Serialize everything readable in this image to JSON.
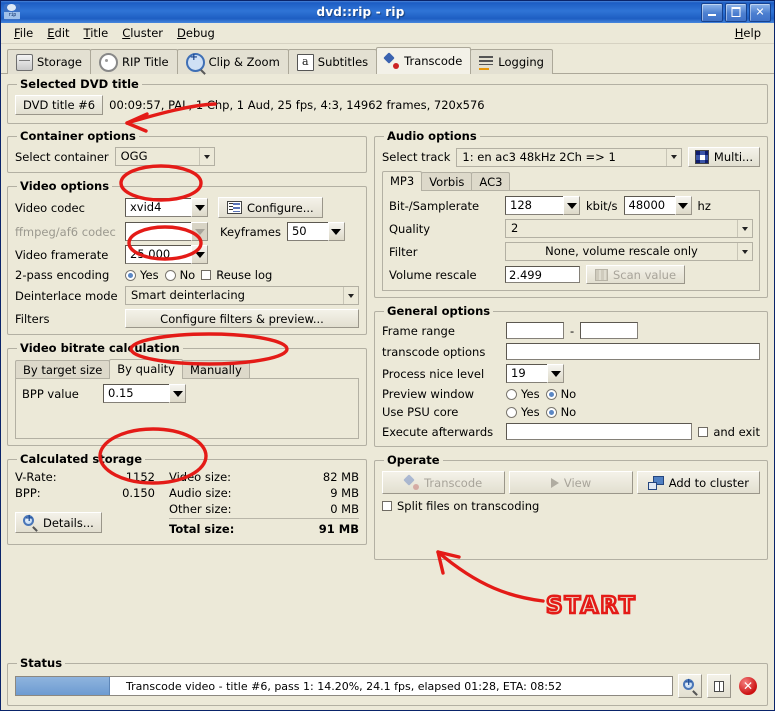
{
  "window": {
    "title": "dvd::rip - rip",
    "icon": "dvdrip-app-icon",
    "minimize_label": "_",
    "maximize_label": "□",
    "close_label": "✕"
  },
  "menubar": {
    "items": [
      {
        "label": "File",
        "mnemonic": "F"
      },
      {
        "label": "Edit",
        "mnemonic": "E"
      },
      {
        "label": "Title",
        "mnemonic": "T"
      },
      {
        "label": "Cluster",
        "mnemonic": "C"
      },
      {
        "label": "Debug",
        "mnemonic": "D"
      }
    ],
    "help": {
      "label": "Help",
      "mnemonic": "H"
    }
  },
  "tabs": [
    {
      "label": "Storage",
      "icon": "storage-icon",
      "active": false
    },
    {
      "label": "RIP Title",
      "icon": "rip-title-icon",
      "active": false
    },
    {
      "label": "Clip & Zoom",
      "icon": "clip-zoom-icon",
      "active": false
    },
    {
      "label": "Subtitles",
      "icon": "subtitles-icon",
      "active": false
    },
    {
      "label": "Transcode",
      "icon": "transcode-icon",
      "active": true
    },
    {
      "label": "Logging",
      "icon": "logging-icon",
      "active": false
    }
  ],
  "selected_dvd_title": {
    "legend": "Selected DVD title",
    "title_button": "DVD title #6",
    "info": "00:09:57, PAL, 1 Chp, 1 Aud, 25 fps, 4:3, 14962 frames, 720x576"
  },
  "container_options": {
    "legend": "Container options",
    "select_container_label": "Select container",
    "container_value": "OGG"
  },
  "video_options": {
    "legend": "Video options",
    "video_codec_label": "Video codec",
    "video_codec_value": "xvid4",
    "configure_button": "Configure...",
    "ffmpeg_codec_label": "ffmpeg/af6 codec",
    "ffmpeg_codec_value": "",
    "keyframes_label": "Keyframes",
    "keyframes_value": "50",
    "framerate_label": "Video framerate",
    "framerate_value": "25.000",
    "two_pass_label": "2-pass encoding",
    "two_pass_yes": "Yes",
    "two_pass_no": "No",
    "two_pass_selected": "Yes",
    "reuse_log_label": "Reuse log",
    "reuse_log_checked": false,
    "deinterlace_label": "Deinterlace mode",
    "deinterlace_value": "Smart deinterlacing",
    "filters_label": "Filters",
    "filters_button": "Configure filters & preview..."
  },
  "video_bitrate": {
    "legend": "Video bitrate calculation",
    "tabs": [
      {
        "label": "By target size",
        "active": false
      },
      {
        "label": "By quality",
        "active": true
      },
      {
        "label": "Manually",
        "active": false
      }
    ],
    "bpp_label": "BPP value",
    "bpp_value": "0.15"
  },
  "calculated_storage": {
    "legend": "Calculated storage",
    "vrate_label": "V-Rate:",
    "vrate_value": "1152",
    "bpp_label": "BPP:",
    "bpp_value": "0.150",
    "video_size_label": "Video size:",
    "video_size_value": "82 MB",
    "audio_size_label": "Audio size:",
    "audio_size_value": "9 MB",
    "other_size_label": "Other size:",
    "other_size_value": "0 MB",
    "total_size_label": "Total size:",
    "total_size_value": "91 MB",
    "details_button": "Details..."
  },
  "audio_options": {
    "legend": "Audio options",
    "select_track_label": "Select track",
    "select_track_value": "1: en ac3 48kHz 2Ch => 1",
    "multi_button": "Multi...",
    "tabs": [
      {
        "label": "MP3",
        "active": true
      },
      {
        "label": "Vorbis",
        "active": false
      },
      {
        "label": "AC3",
        "active": false
      }
    ],
    "bitrate_label": "Bit-/Samplerate",
    "bitrate_value": "128",
    "kbits_label": "kbit/s",
    "samplerate_value": "48000",
    "hz_label": "hz",
    "quality_label": "Quality",
    "quality_value": "2",
    "filter_label": "Filter",
    "filter_value": "None, volume rescale only",
    "volume_rescale_label": "Volume rescale",
    "volume_rescale_value": "2.499",
    "scan_value_button": "Scan value"
  },
  "general_options": {
    "legend": "General options",
    "frame_range_label": "Frame range",
    "frame_range_from": "",
    "frame_range_sep": "-",
    "frame_range_to": "",
    "transcode_options_label": "transcode options",
    "transcode_options_value": "",
    "nice_level_label": "Process nice level",
    "nice_level_value": "19",
    "preview_window_label": "Preview window",
    "preview_yes": "Yes",
    "preview_no": "No",
    "preview_selected": "No",
    "psu_core_label": "Use PSU core",
    "psu_yes": "Yes",
    "psu_no": "No",
    "psu_selected": "No",
    "execute_label": "Execute afterwards",
    "execute_value": "",
    "and_exit_label": "and exit",
    "and_exit_checked": false
  },
  "operate": {
    "legend": "Operate",
    "transcode_button": "Transcode",
    "transcode_enabled": false,
    "view_button": "View",
    "view_enabled": false,
    "add_to_cluster_button": "Add to cluster",
    "split_files_label": "Split files on transcoding",
    "split_files_checked": false
  },
  "status": {
    "legend": "Status",
    "progress_text": "Transcode video - title #6, pass 1: 14.20%, 24.1 fps, elapsed 01:28, ETA: 08:52",
    "progress_percent": 14.2,
    "zoom_button_icon": "magnifier-plus-icon",
    "pause_button_icon": "pause-icon",
    "stop_button_icon": "stop-icon",
    "stop_glyph": "✕"
  },
  "annotations": {
    "color": "#e41b17",
    "start_text": "START",
    "marks": [
      "arrow-to-dvd-title",
      "circle-around-container-ogg",
      "circle-around-video-codec",
      "circle-around-deinterlace-mode",
      "circle-around-bpp-value",
      "arrow-to-transcode-button"
    ]
  }
}
